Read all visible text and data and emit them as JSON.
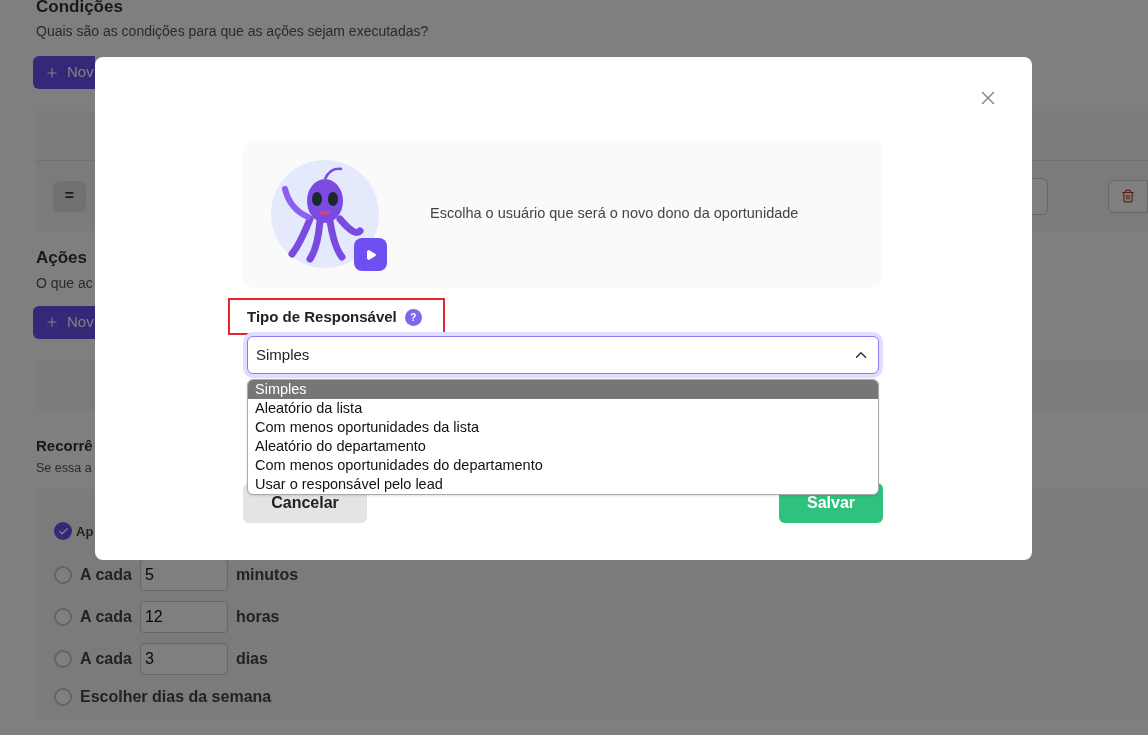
{
  "conditions": {
    "title": "Condições",
    "subtitle": "Quais são as condições para que as ações sejam executadas?",
    "add_button": "Nov",
    "operator": "="
  },
  "actions": {
    "title": "Ações",
    "subtitle": "O que ac",
    "add_button": "Nov"
  },
  "recurrence": {
    "title": "Recorrê",
    "subtitle": "Se essa a",
    "options": [
      {
        "kind": "plain",
        "label": "Ap",
        "selected": true
      },
      {
        "kind": "interval",
        "label": "A cada",
        "value": "5",
        "unit": "minutos",
        "selected": false
      },
      {
        "kind": "interval",
        "label": "A cada",
        "value": "12",
        "unit": "horas",
        "selected": false
      },
      {
        "kind": "interval",
        "label": "A cada",
        "value": "3",
        "unit": "dias",
        "selected": false
      },
      {
        "kind": "plain",
        "label": "Escolher dias da semana",
        "selected": false
      }
    ]
  },
  "modal": {
    "info_text": "Escolha o usuário que será o novo dono da oportunidade",
    "field_label": "Tipo de Responsável",
    "help_icon": "?",
    "highlighted": true,
    "select": {
      "value": "Simples",
      "expanded": true,
      "options": [
        {
          "label": "Simples",
          "selected": true
        },
        {
          "label": "Aleatório da lista",
          "selected": false
        },
        {
          "label": "Com menos oportunidades da lista",
          "selected": false
        },
        {
          "label": "Aleatório do departamento",
          "selected": false
        },
        {
          "label": "Com menos oportunidades do departamento",
          "selected": false
        },
        {
          "label": "Usar o responsável pelo lead",
          "selected": false
        }
      ]
    },
    "buttons": {
      "cancel": "Cancelar",
      "save": "Salvar"
    }
  }
}
